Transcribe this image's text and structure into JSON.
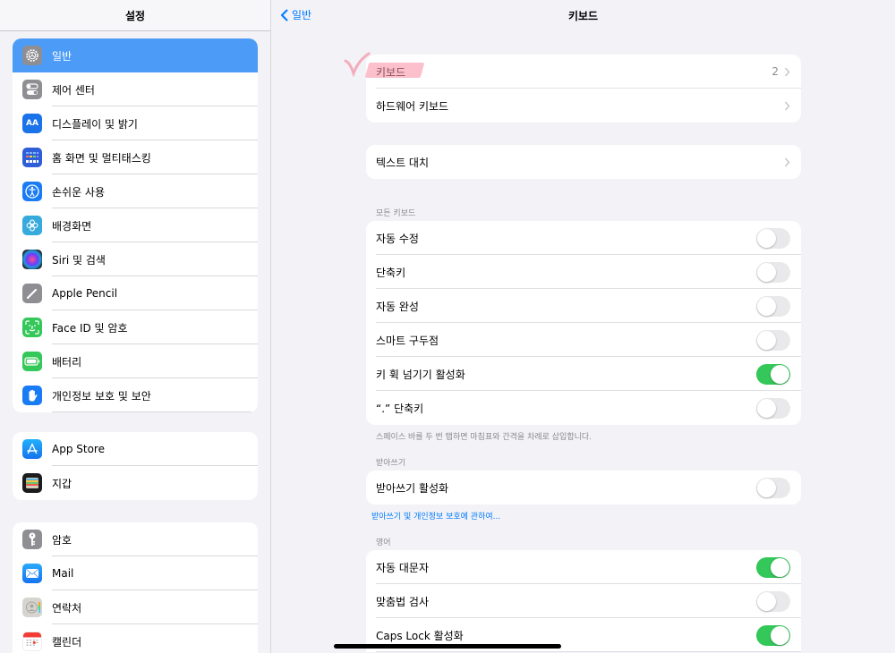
{
  "sidebar": {
    "title": "설정",
    "groups": [
      {
        "items": [
          {
            "label": "일반",
            "icon": "gear-icon",
            "color": "#8e8e93",
            "active": true
          },
          {
            "label": "제어 센터",
            "icon": "control-center-icon",
            "color": "#8e8e93"
          },
          {
            "label": "디스플레이 및 밝기",
            "icon": "display-brightness-icon",
            "color": "#1a73e8",
            "glyph": "AA"
          },
          {
            "label": "홈 화면 및 멀티태스킹",
            "icon": "home-screen-icon",
            "color": "#2f5fd8"
          },
          {
            "label": "손쉬운 사용",
            "icon": "accessibility-icon",
            "color": "#1a7cf5"
          },
          {
            "label": "배경화면",
            "icon": "wallpaper-icon",
            "color": "#36aadc"
          },
          {
            "label": "Siri 및 검색",
            "icon": "siri-icon",
            "color": "#2a2a3a"
          },
          {
            "label": "Apple Pencil",
            "icon": "pencil-icon",
            "color": "#8e8e93"
          },
          {
            "label": "Face ID 및 암호",
            "icon": "face-id-icon",
            "color": "#34c759"
          },
          {
            "label": "배터리",
            "icon": "battery-icon",
            "color": "#34c759"
          },
          {
            "label": "개인정보 보호 및 보안",
            "icon": "privacy-hand-icon",
            "color": "#1a7cf5"
          }
        ]
      },
      {
        "items": [
          {
            "label": "App Store",
            "icon": "app-store-icon",
            "color": "#1c8ef9"
          },
          {
            "label": "지갑",
            "icon": "wallet-icon",
            "color": "#1c1c1e"
          }
        ]
      },
      {
        "items": [
          {
            "label": "암호",
            "icon": "key-icon",
            "color": "#8e8e93"
          },
          {
            "label": "Mail",
            "icon": "mail-icon",
            "color": "#1e8cf5"
          },
          {
            "label": "연락처",
            "icon": "contacts-icon",
            "color": "#d0d0cc"
          },
          {
            "label": "캘린더",
            "icon": "calendar-icon",
            "color": "#ffffff"
          }
        ]
      }
    ]
  },
  "nav": {
    "back_label": "일반",
    "title": "키보드"
  },
  "main": {
    "group1": [
      {
        "label": "키보드",
        "value": "2",
        "chevron": true
      },
      {
        "label": "하드웨어 키보드",
        "chevron": true
      }
    ],
    "group2": [
      {
        "label": "텍스트 대치",
        "chevron": true
      }
    ],
    "all_keyboards": {
      "header": "모든 키보드",
      "rows": [
        {
          "label": "자동 수정",
          "on": false
        },
        {
          "label": "단축키",
          "on": false
        },
        {
          "label": "자동 완성",
          "on": false
        },
        {
          "label": "스마트 구두점",
          "on": false
        },
        {
          "label": "키 휙 넘기기 활성화",
          "on": true
        },
        {
          "label": "“.” 단축키",
          "on": false
        }
      ],
      "footer": "스페이스 바를 두 번 탭하면 마침표와 간격을 차례로 삽입합니다."
    },
    "dictation": {
      "header": "받아쓰기",
      "rows": [
        {
          "label": "받아쓰기 활성화",
          "on": false
        }
      ],
      "link": "받아쓰기 및 개인정보 보호에 관하여..."
    },
    "english": {
      "header": "영어",
      "rows": [
        {
          "label": "자동 대문자",
          "on": true
        },
        {
          "label": "맞춤법 검사",
          "on": false
        },
        {
          "label": "Caps Lock 활성화",
          "on": true
        }
      ]
    }
  },
  "colors": {
    "accent": "#007aff",
    "toggle_on": "#34c759",
    "sidebar_active": "#4c9cf7",
    "annotation": "#f88ca0"
  }
}
